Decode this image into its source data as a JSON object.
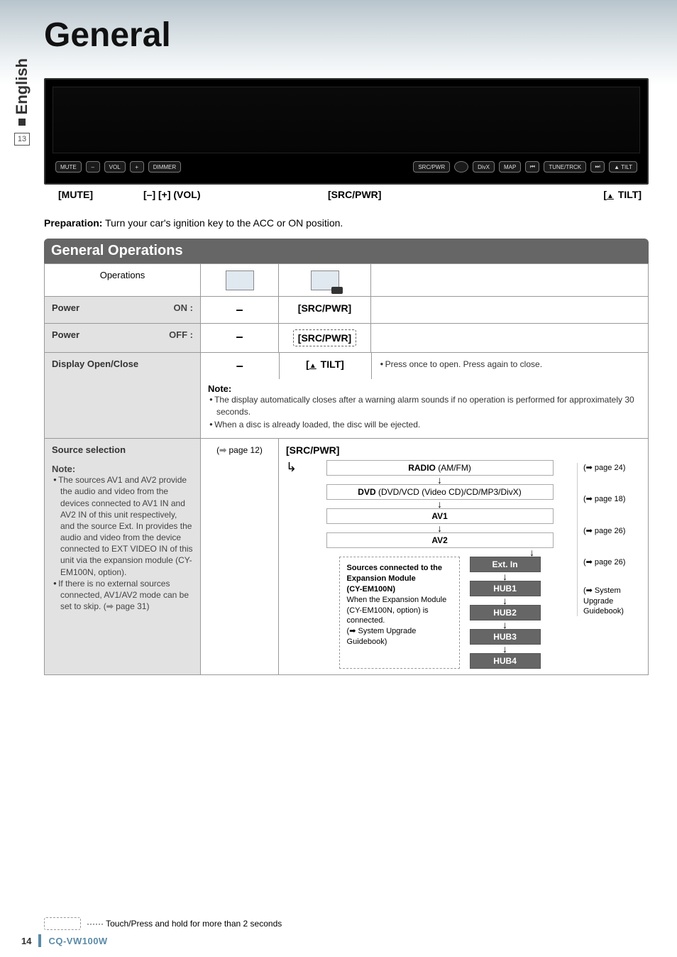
{
  "side": {
    "lang": "English",
    "page_top": "13"
  },
  "title": "General",
  "device_buttons": {
    "mute": "MUTE",
    "minus": "–",
    "vol": "VOL",
    "plus": "+",
    "dimmer": "DIMMER",
    "src": "SRC/PWR",
    "divx": "DivX",
    "map": "MAP",
    "tune_prev": "⏮",
    "tune": "TUNE/TRCK",
    "tune_next": "⏭",
    "tilt": "▲ TILT"
  },
  "captions": {
    "mute": "[MUTE]",
    "vol": "[–] [+] (VOL)",
    "src": "[SRC/PWR]",
    "tilt_prefix": "[",
    "tilt_label": " TILT]"
  },
  "prep_label": "Preparation:",
  "prep_text": " Turn your car's ignition key to the ACC or ON position.",
  "section": "General Operations",
  "head": {
    "ops": "Operations"
  },
  "rows": {
    "power_on": {
      "label": "Power",
      "sub": "ON :",
      "panel": "[SRC/PWR]",
      "touch": "–"
    },
    "power_off": {
      "label": "Power",
      "sub": "OFF :",
      "panel": "[SRC/PWR]",
      "touch": "–"
    },
    "display": {
      "label": "Display Open/Close",
      "touch": "–",
      "panel_prefix": "[",
      "panel_label": " TILT]",
      "desc_bullet": "Press once to open. Press again to close.",
      "note_label": "Note:",
      "note1": "The display automatically closes after a warning alarm sounds if no operation is performed for approximately 30 seconds.",
      "note2": "When a disc is already loaded, the disc will be ejected."
    },
    "source": {
      "label": "Source selection",
      "note_label": "Note:",
      "note1": "The sources AV1 and AV2 provide the audio and video from the devices connected to AV1 IN and AV2 IN of this unit respectively, and the source Ext. In provides the audio and video from the device connected to EXT VIDEO IN of this unit via the expansion module (CY-EM100N, option).",
      "note2_a": "If there is no external sources connected, AV1/AV2 mode can be set to skip. (",
      "note2_b": " page 31)",
      "touch_a": "(",
      "touch_b": " page 12)",
      "panel": "[SRC/PWR]"
    }
  },
  "flow": {
    "radio": "RADIO",
    "radio_sub": " (AM/FM)",
    "dvd": "DVD",
    "dvd_sub": " (DVD/VCD (Video CD)/CD/MP3/DivX)",
    "av1": "AV1",
    "av2": "AV2",
    "expansion_title": "Sources connected to the Expansion Module",
    "expansion_model": "(CY-EM100N)",
    "expansion_body_a": "When the Expansion Module (CY-EM100N, option) is connected.",
    "expansion_body_b": "(➡ System Upgrade Guidebook)",
    "extin": "Ext. In",
    "hub1": "HUB1",
    "hub2": "HUB2",
    "hub3": "HUB3",
    "hub4": "HUB4"
  },
  "refs": {
    "p24": "(➡ page 24)",
    "p18": "(➡ page 18)",
    "p26a": "(➡ page 26)",
    "p26b": "(➡ page 26)",
    "sys": "(➡ System Upgrade Guidebook)"
  },
  "legend": " ······ Touch/Press and hold for more than 2 seconds",
  "footer": {
    "page": "14",
    "model": "CQ-VW100W"
  }
}
